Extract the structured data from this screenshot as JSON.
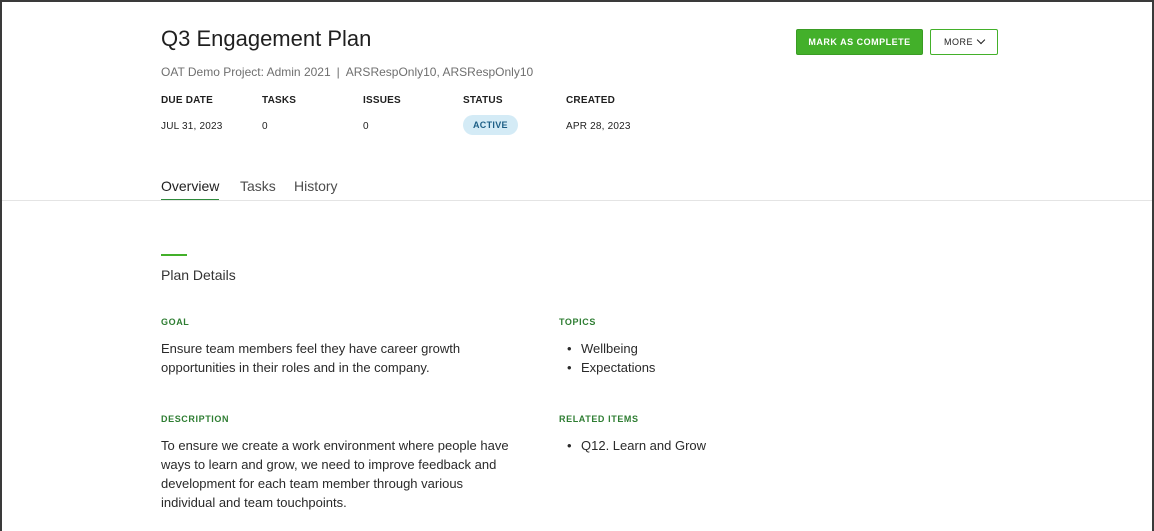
{
  "plan": {
    "title": "Q3 Engagement Plan",
    "project": "OAT Demo Project: Admin 2021",
    "owner": "ARSRespOnly10, ARSRespOnly10"
  },
  "actions": {
    "complete_label": "MARK AS COMPLETE",
    "more_label": "MORE"
  },
  "stats": {
    "due_date": {
      "label": "DUE DATE",
      "value": "JUL 31, 2023"
    },
    "tasks": {
      "label": "TASKS",
      "value": "0"
    },
    "issues": {
      "label": "ISSUES",
      "value": "0"
    },
    "status": {
      "label": "STATUS",
      "value": "ACTIVE"
    },
    "created": {
      "label": "CREATED",
      "value": "APR 28, 2023"
    }
  },
  "tabs": [
    {
      "label": "Overview",
      "active": true
    },
    {
      "label": "Tasks",
      "active": false
    },
    {
      "label": "History",
      "active": false
    }
  ],
  "details": {
    "section_title": "Plan Details",
    "goal": {
      "label": "GOAL",
      "lines": [
        "Ensure team members feel they have career growth",
        "opportunities in their roles and in the company."
      ]
    },
    "topics": {
      "label": "TOPICS",
      "items": [
        "Wellbeing",
        "Expectations"
      ]
    },
    "description": {
      "label": "DESCRIPTION",
      "lines": [
        "To ensure we create a work environment where people have",
        "ways to learn and grow, we need to improve feedback and",
        "development for each team member through various",
        "individual and team touchpoints."
      ]
    },
    "related": {
      "label": "RELATED ITEMS",
      "items": [
        "Q12. Learn and Grow"
      ]
    }
  },
  "colors": {
    "accent_green": "#43b02a",
    "label_green": "#2e7d32",
    "status_badge_bg": "#d4ebf6",
    "status_badge_text": "#1d5f86"
  },
  "icons": {
    "more_dropdown": "chevron-down-icon"
  }
}
